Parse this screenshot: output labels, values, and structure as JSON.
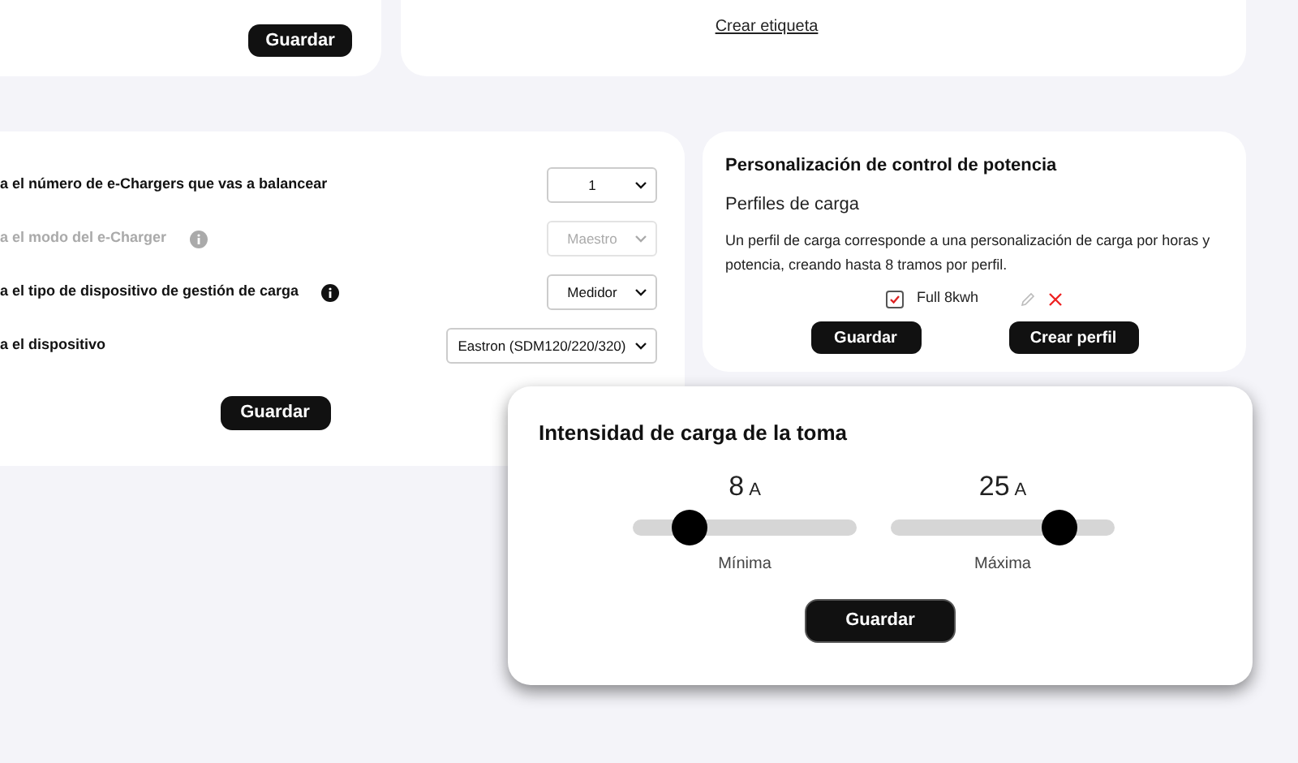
{
  "top_left_card": {
    "button": "Guardar"
  },
  "top_right_card": {
    "link": "Crear etiqueta"
  },
  "device_card": {
    "fields": [
      {
        "label": "a el número de e-Chargers que vas a balancear",
        "value": "1",
        "disabled": false,
        "info": false
      },
      {
        "label": "a el modo del e-Charger",
        "value": "Maestro",
        "disabled": true,
        "info": true
      },
      {
        "label": "a el tipo de dispositivo de gestión de carga",
        "value": "Medidor",
        "disabled": false,
        "info": true
      },
      {
        "label": "a el dispositivo",
        "value": "Eastron (SDM120/220/320)",
        "disabled": false,
        "info": false
      }
    ],
    "button": "Guardar"
  },
  "profiles_card": {
    "title": "Personalización de control de potencia",
    "subtitle": "Perfiles de carga",
    "description": "Un perfil de carga corresponde a una personalización de carga por horas y potencia, creando hasta 8 tramos por perfil.",
    "profiles": [
      {
        "name": "Full 8kwh",
        "checked": true
      }
    ],
    "buttons": [
      "Guardar",
      "Crear perfil"
    ]
  },
  "intensity_card": {
    "title": "Intensidad de carga de la toma",
    "sliders": [
      {
        "value": "8",
        "unit": "A",
        "label": "Mínima",
        "level": 0.25
      },
      {
        "value": "25",
        "unit": "A",
        "label": "Máxima",
        "level": 0.75
      }
    ],
    "button": "Guardar"
  }
}
